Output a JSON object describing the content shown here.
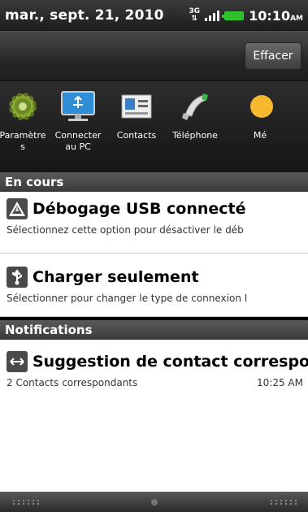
{
  "status_bar": {
    "date": "mar., sept. 21, 2010",
    "network": "3G",
    "time": "10:10",
    "ampm": "AM",
    "battery_color": "#2fbf2f"
  },
  "header": {
    "clear_label": "Effacer"
  },
  "quick_settings": [
    {
      "label": "Paramètre\ns",
      "icon": "gear-icon"
    },
    {
      "label": "Connecter\nau PC",
      "icon": "computer-usb-icon"
    },
    {
      "label": "Contacts",
      "icon": "contacts-icon"
    },
    {
      "label": "Téléphone",
      "icon": "phone-icon"
    },
    {
      "label": "Mé",
      "icon": "weather-icon"
    }
  ],
  "sections": {
    "ongoing": "En cours",
    "notifications": "Notifications"
  },
  "ongoing_items": [
    {
      "title": "Débogage USB connecté",
      "subtitle": "Sélectionnez cette option pour désactiver le déb",
      "icon": "warning-icon"
    },
    {
      "title": "Charger seulement",
      "subtitle": "Sélectionner pour changer le type de connexion I",
      "icon": "usb-icon"
    }
  ],
  "notification_items": [
    {
      "title": "Suggestion de contact correspond",
      "subtitle": "2 Contacts correspondants",
      "time": "10:25 AM",
      "icon": "contact-link-icon"
    }
  ]
}
